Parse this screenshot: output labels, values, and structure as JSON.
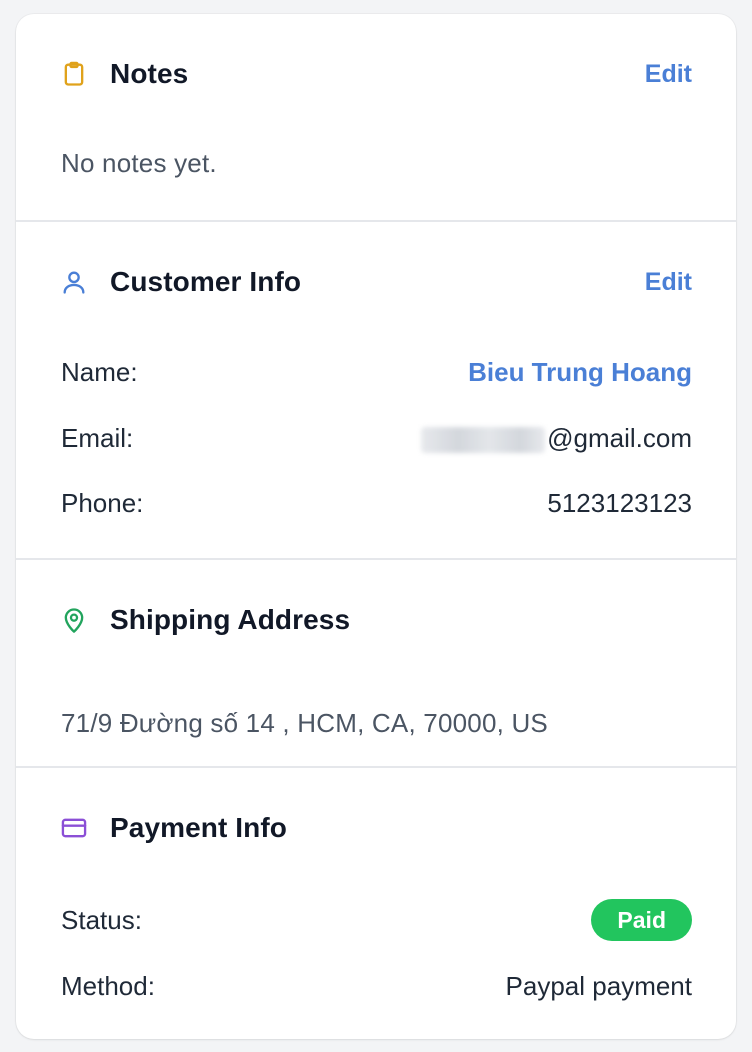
{
  "notes": {
    "title": "Notes",
    "edit_label": "Edit",
    "empty_text": "No notes yet."
  },
  "customer": {
    "title": "Customer Info",
    "edit_label": "Edit",
    "name_label": "Name:",
    "name_value": "Bieu Trung Hoang",
    "email_label": "Email:",
    "email_domain": "@gmail.com",
    "phone_label": "Phone:",
    "phone_value": "5123123123"
  },
  "shipping": {
    "title": "Shipping Address",
    "address": "71/9 Đường số 14 , HCM, CA, 70000, US"
  },
  "payment": {
    "title": "Payment Info",
    "status_label": "Status:",
    "status_value": "Paid",
    "method_label": "Method:",
    "method_value": "Paypal payment"
  },
  "icons": {
    "notes": "clipboard-icon",
    "customer": "user-icon",
    "shipping": "map-pin-icon",
    "payment": "credit-card-icon"
  },
  "colors": {
    "accent": "#4a7fd6",
    "notes_icon": "#e0a21b",
    "customer_icon": "#4a7fd6",
    "shipping_icon": "#22a45d",
    "payment_icon": "#8b4fd6",
    "paid_badge": "#22c55e"
  }
}
